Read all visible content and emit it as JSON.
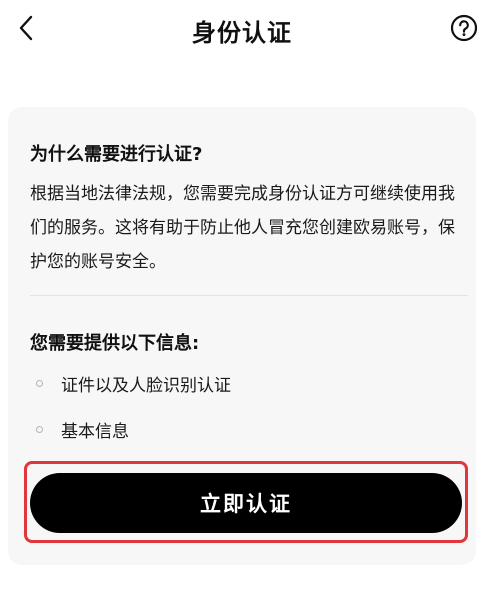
{
  "header": {
    "title": "身份认证",
    "back_icon": "chevron-left-icon",
    "help_icon": "question-circle-icon"
  },
  "reason": {
    "title": "为什么需要进行认证?",
    "text": "根据当地法律法规，您需要完成身份认证方可继续使用我们的服务。这将有助于防止他人冒充您创建欧易账号，保护您的账号安全。"
  },
  "requirements": {
    "title": "您需要提供以下信息:",
    "items": [
      "证件以及人脸识别认证",
      "基本信息"
    ]
  },
  "actions": {
    "verify_label": "立即认证"
  },
  "colors": {
    "card_bg": "#f7f7f7",
    "button_bg": "#000000",
    "button_text": "#ffffff",
    "highlight": "#e2353c"
  }
}
